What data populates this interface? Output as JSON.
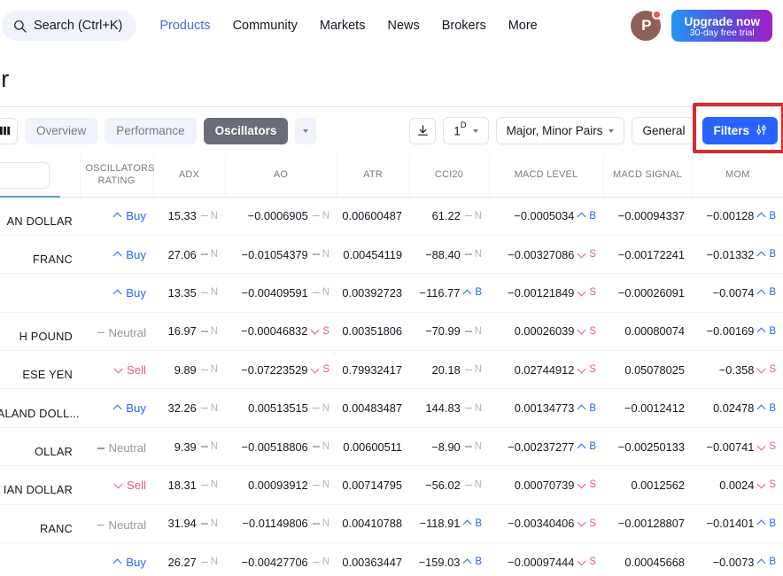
{
  "topnav": {
    "search": {
      "placeholder": "Search (Ctrl+K)",
      "icon": "search-icon"
    },
    "links": [
      {
        "label": "Products",
        "active": true
      },
      {
        "label": "Community",
        "active": false
      },
      {
        "label": "Markets",
        "active": false
      },
      {
        "label": "News",
        "active": false
      },
      {
        "label": "Brokers",
        "active": false
      },
      {
        "label": "More",
        "active": false
      }
    ],
    "avatar": {
      "initial": "P",
      "has_notification": true,
      "color": "#8f6055"
    },
    "upgrade": {
      "title": "Upgrade now",
      "subtitle": "30-day free trial"
    }
  },
  "page": {
    "title": "er"
  },
  "toolbar": {
    "grid_icon": "columns-icon",
    "tabs": [
      {
        "label": "Overview",
        "active": false
      },
      {
        "label": "Performance",
        "active": false
      },
      {
        "label": "Oscillators",
        "active": true
      }
    ],
    "tabs_more_icon": "chevron-down-icon",
    "download_icon": "download-icon",
    "timeframe": {
      "value": "1",
      "unit": "D"
    },
    "market_filter": "Major, Minor Pairs",
    "general_label": "General",
    "filters_label": "Filters",
    "filters_icon": "sliders-icon",
    "filters_color": "#2962ff",
    "highlight_color": "#d92b2b"
  },
  "table": {
    "columns": [
      "",
      "OSCILLATORS RATING",
      "ADX",
      "AO",
      "ATR",
      "CCI20",
      "MACD LEVEL",
      "MACD SIGNAL",
      "MOM"
    ],
    "symbol_search_value": "",
    "rows": [
      {
        "symbol": "AN DOLLAR",
        "rating": {
          "label": "Buy",
          "type": "buy"
        },
        "adx": {
          "value": "15.33",
          "signal": "N"
        },
        "ao": {
          "value": "−0.0006905",
          "signal": "N"
        },
        "atr": {
          "value": "0.00600487",
          "signal": ""
        },
        "cci20": {
          "value": "61.22",
          "signal": "N"
        },
        "macd_level": {
          "value": "−0.0005034",
          "signal": "B"
        },
        "macd_signal": {
          "value": "−0.00094337",
          "signal": ""
        },
        "mom": {
          "value": "−0.00128",
          "signal": "B"
        }
      },
      {
        "symbol": "FRANC",
        "rating": {
          "label": "Buy",
          "type": "buy"
        },
        "adx": {
          "value": "27.06",
          "signal": "N"
        },
        "ao": {
          "value": "−0.01054379",
          "signal": "N"
        },
        "atr": {
          "value": "0.00454119",
          "signal": ""
        },
        "cci20": {
          "value": "−88.40",
          "signal": "N"
        },
        "macd_level": {
          "value": "−0.00327086",
          "signal": "S"
        },
        "macd_signal": {
          "value": "−0.00172241",
          "signal": ""
        },
        "mom": {
          "value": "−0.01332",
          "signal": "B"
        }
      },
      {
        "symbol": "",
        "rating": {
          "label": "Buy",
          "type": "buy"
        },
        "adx": {
          "value": "13.35",
          "signal": "N"
        },
        "ao": {
          "value": "−0.00409591",
          "signal": "N"
        },
        "atr": {
          "value": "0.00392723",
          "signal": ""
        },
        "cci20": {
          "value": "−116.77",
          "signal": "B"
        },
        "macd_level": {
          "value": "−0.00121849",
          "signal": "S"
        },
        "macd_signal": {
          "value": "−0.00026091",
          "signal": ""
        },
        "mom": {
          "value": "−0.0074",
          "signal": "B"
        }
      },
      {
        "symbol": "H POUND",
        "rating": {
          "label": "Neutral",
          "type": "neutral"
        },
        "adx": {
          "value": "16.97",
          "signal": "N"
        },
        "ao": {
          "value": "−0.00046832",
          "signal": "S"
        },
        "atr": {
          "value": "0.00351806",
          "signal": ""
        },
        "cci20": {
          "value": "−70.99",
          "signal": "N"
        },
        "macd_level": {
          "value": "0.00026039",
          "signal": "S"
        },
        "macd_signal": {
          "value": "0.00080074",
          "signal": ""
        },
        "mom": {
          "value": "−0.00169",
          "signal": "B"
        }
      },
      {
        "symbol": "ESE YEN",
        "rating": {
          "label": "Sell",
          "type": "sell"
        },
        "adx": {
          "value": "9.89",
          "signal": "N"
        },
        "ao": {
          "value": "−0.07223529",
          "signal": "S"
        },
        "atr": {
          "value": "0.79932417",
          "signal": ""
        },
        "cci20": {
          "value": "20.18",
          "signal": "N"
        },
        "macd_level": {
          "value": "0.02744912",
          "signal": "S"
        },
        "macd_signal": {
          "value": "0.05078025",
          "signal": ""
        },
        "mom": {
          "value": "−0.358",
          "signal": "S"
        }
      },
      {
        "symbol": "EALAND DOLL...",
        "rating": {
          "label": "Buy",
          "type": "buy"
        },
        "adx": {
          "value": "32.26",
          "signal": "N"
        },
        "ao": {
          "value": "0.00513515",
          "signal": "N"
        },
        "atr": {
          "value": "0.00483487",
          "signal": ""
        },
        "cci20": {
          "value": "144.83",
          "signal": "N"
        },
        "macd_level": {
          "value": "0.00134773",
          "signal": "B"
        },
        "macd_signal": {
          "value": "−0.0012412",
          "signal": ""
        },
        "mom": {
          "value": "0.02478",
          "signal": "B"
        }
      },
      {
        "symbol": "OLLAR",
        "rating": {
          "label": "Neutral",
          "type": "neutral"
        },
        "adx": {
          "value": "9.39",
          "signal": "N"
        },
        "ao": {
          "value": "−0.00518806",
          "signal": "N"
        },
        "atr": {
          "value": "0.00600511",
          "signal": ""
        },
        "cci20": {
          "value": "−8.90",
          "signal": "N"
        },
        "macd_level": {
          "value": "−0.00237277",
          "signal": "B"
        },
        "macd_signal": {
          "value": "−0.00250133",
          "signal": ""
        },
        "mom": {
          "value": "−0.00741",
          "signal": "S"
        }
      },
      {
        "symbol": "IAN DOLLAR",
        "rating": {
          "label": "Sell",
          "type": "sell"
        },
        "adx": {
          "value": "18.31",
          "signal": "N"
        },
        "ao": {
          "value": "0.00093912",
          "signal": "N"
        },
        "atr": {
          "value": "0.00714795",
          "signal": ""
        },
        "cci20": {
          "value": "−56.02",
          "signal": "N"
        },
        "macd_level": {
          "value": "0.00070739",
          "signal": "S"
        },
        "macd_signal": {
          "value": "0.0012562",
          "signal": ""
        },
        "mom": {
          "value": "0.0024",
          "signal": "S"
        }
      },
      {
        "symbol": "RANC",
        "rating": {
          "label": "Neutral",
          "type": "neutral"
        },
        "adx": {
          "value": "31.94",
          "signal": "N"
        },
        "ao": {
          "value": "−0.01149806",
          "signal": "N"
        },
        "atr": {
          "value": "0.00410788",
          "signal": ""
        },
        "cci20": {
          "value": "−118.91",
          "signal": "B"
        },
        "macd_level": {
          "value": "−0.00340406",
          "signal": "S"
        },
        "macd_signal": {
          "value": "−0.00128807",
          "signal": ""
        },
        "mom": {
          "value": "−0.01401",
          "signal": "B"
        }
      },
      {
        "symbol": "",
        "rating": {
          "label": "Buy",
          "type": "buy"
        },
        "adx": {
          "value": "26.27",
          "signal": "N"
        },
        "ao": {
          "value": "−0.00427706",
          "signal": "N"
        },
        "atr": {
          "value": "0.00363447",
          "signal": ""
        },
        "cci20": {
          "value": "−159.03",
          "signal": "B"
        },
        "macd_level": {
          "value": "−0.00097444",
          "signal": "S"
        },
        "macd_signal": {
          "value": "0.00045668",
          "signal": ""
        },
        "mom": {
          "value": "−0.0073",
          "signal": "B"
        }
      }
    ]
  }
}
